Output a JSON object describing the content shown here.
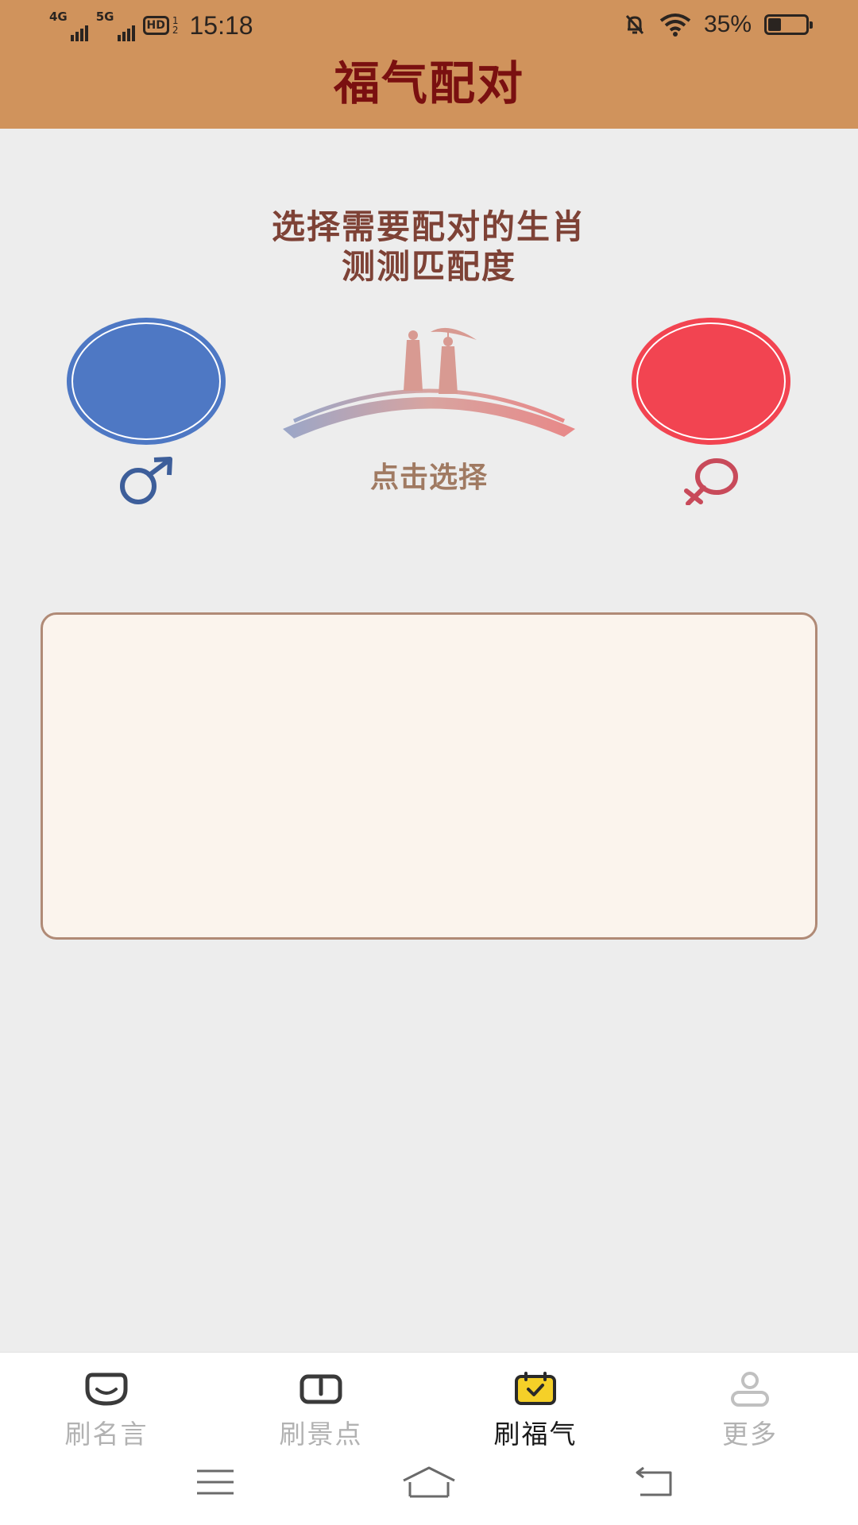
{
  "status_bar": {
    "network_1": "4G",
    "network_2": "5G",
    "hd_badge": "HD",
    "hd_sub_top": "1",
    "hd_sub_bottom": "2",
    "time": "15:18",
    "battery_percent": "35%",
    "battery_level": 0.35,
    "icons": [
      "mute-bell-icon",
      "wifi-icon",
      "battery-icon"
    ]
  },
  "header": {
    "title": "福气配对",
    "background": "#d0935c",
    "title_color": "#7a1010"
  },
  "main": {
    "subtitle_line1": "选择需要配对的生肖",
    "subtitle_line2": "测测匹配度",
    "tap_label": "点击选择",
    "male_color": "#4e78c4",
    "female_color": "#f24451",
    "icons": [
      "male-symbol-icon",
      "female-symbol-icon",
      "bridge-couple-illustration"
    ]
  },
  "tabs": [
    {
      "label": "刷名言",
      "icon": "smile-face-icon",
      "active": false
    },
    {
      "label": "刷景点",
      "icon": "book-icon",
      "active": false
    },
    {
      "label": "刷福气",
      "icon": "calendar-check-icon",
      "active": true
    },
    {
      "label": "更多",
      "icon": "person-icon",
      "active": false
    }
  ],
  "nav": {
    "icons": [
      "menu-icon",
      "home-icon",
      "back-icon"
    ]
  }
}
